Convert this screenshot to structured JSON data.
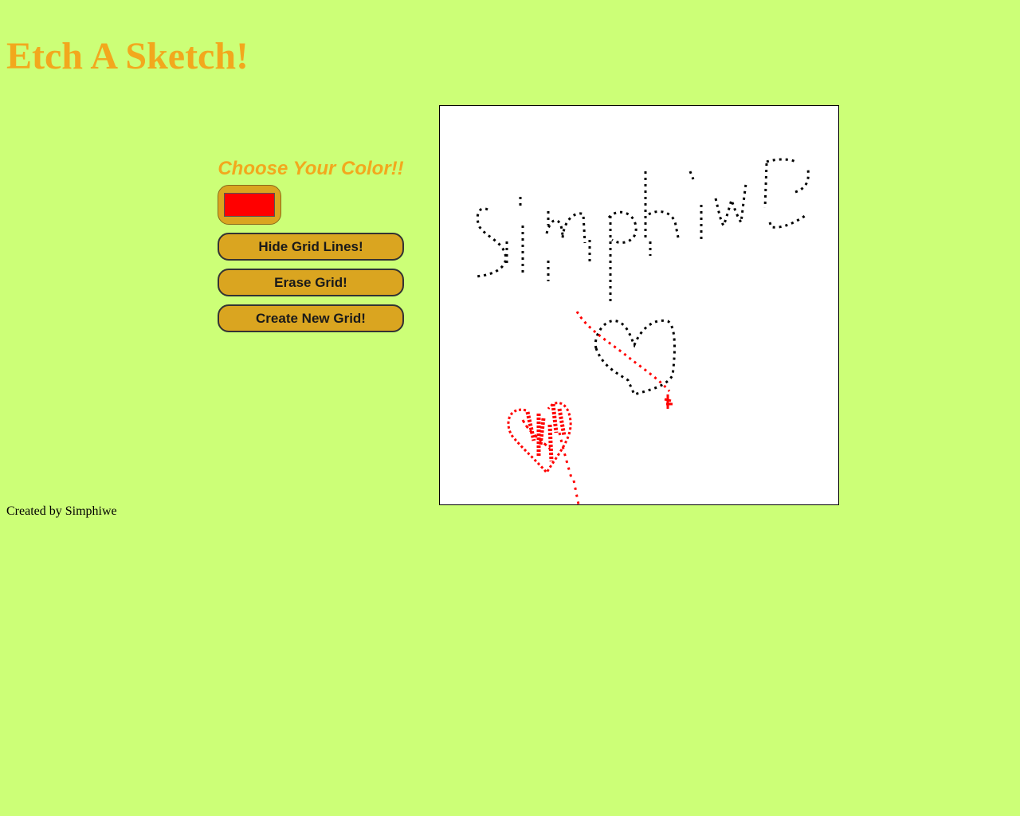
{
  "page": {
    "title": "Etch A Sketch!",
    "footer": "Created by Simphiwe"
  },
  "controls": {
    "choose_label": "Choose Your Color!!",
    "selected_color": "#ff0000",
    "hide_grid_label": "Hide Grid Lines!",
    "erase_label": "Erase Grid!",
    "create_label": "Create New Grid!"
  },
  "colors": {
    "background": "#ccff77",
    "accent": "#f2a81d",
    "button": "#daa520",
    "ink_black": "#000000",
    "ink_red": "#ff0000"
  }
}
